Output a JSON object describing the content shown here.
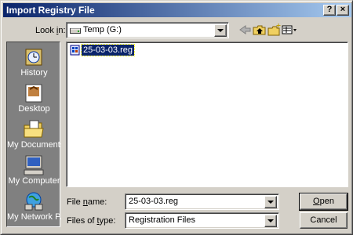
{
  "window": {
    "title": "Import Registry File",
    "help_button": "?",
    "close_button": "×"
  },
  "look_in": {
    "label_pre": "Look ",
    "label_ul": "i",
    "label_post": "n:",
    "value": "Temp (G:)"
  },
  "places": [
    {
      "label": "History",
      "icon": "history-icon"
    },
    {
      "label": "Desktop",
      "icon": "desktop-icon"
    },
    {
      "label": "My Documents",
      "icon": "my-documents-icon"
    },
    {
      "label": "My Computer",
      "icon": "my-computer-icon"
    },
    {
      "label": "My Network P...",
      "icon": "my-network-places-icon"
    }
  ],
  "files": [
    {
      "name": "25-03-03.reg",
      "icon": "registry-file-icon",
      "selected": true
    }
  ],
  "file_name": {
    "label_pre": "File ",
    "label_ul": "n",
    "label_post": "ame:",
    "value": "25-03-03.reg"
  },
  "file_type": {
    "label_pre": "Files of ",
    "label_ul": "t",
    "label_post": "ype:",
    "value": "Registration Files"
  },
  "buttons": {
    "open_ul": "O",
    "open_rest": "pen",
    "cancel": "Cancel"
  },
  "toolbar_icons": [
    "back-icon",
    "up-folder-icon",
    "new-folder-icon",
    "view-menu-icon"
  ]
}
